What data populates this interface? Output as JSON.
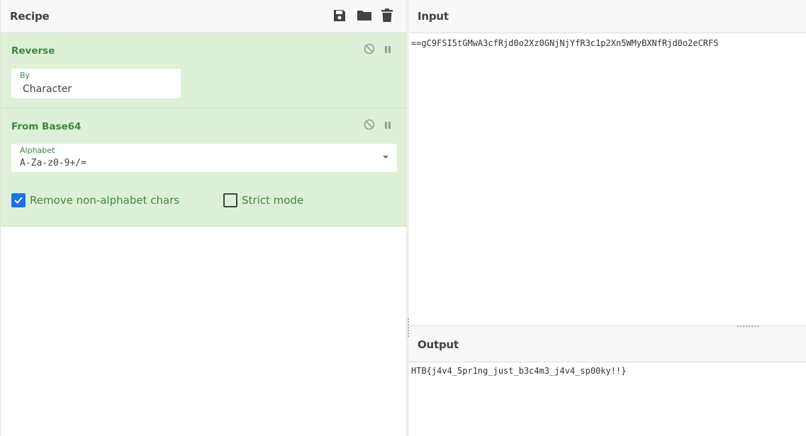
{
  "recipe": {
    "title": "Recipe",
    "icons": [
      "save-icon",
      "folder-icon",
      "trash-icon"
    ],
    "operations": [
      {
        "name": "Reverse",
        "fields": [
          {
            "label": "By",
            "value": "Character"
          }
        ]
      },
      {
        "name": "From Base64",
        "fields": [
          {
            "label": "Alphabet",
            "value": "A-Za-z0-9+/="
          }
        ],
        "checkboxes": [
          {
            "label": "Remove non-alphabet chars",
            "checked": true
          },
          {
            "label": "Strict mode",
            "checked": false
          }
        ]
      }
    ]
  },
  "input": {
    "title": "Input",
    "value": "==gC9FSI5tGMwA3cfRjd0o2Xz0GNjNjYfR3c1p2Xn5WMyBXNfRjd0o2eCRFS"
  },
  "output": {
    "title": "Output",
    "value": "HTB{j4v4_5pr1ng_just_b3c4m3_j4v4_sp00ky!!}"
  },
  "colors": {
    "op_bg": "#dff0d8",
    "op_title": "#3c8a3c",
    "checkbox_on": "#1a73e8"
  }
}
